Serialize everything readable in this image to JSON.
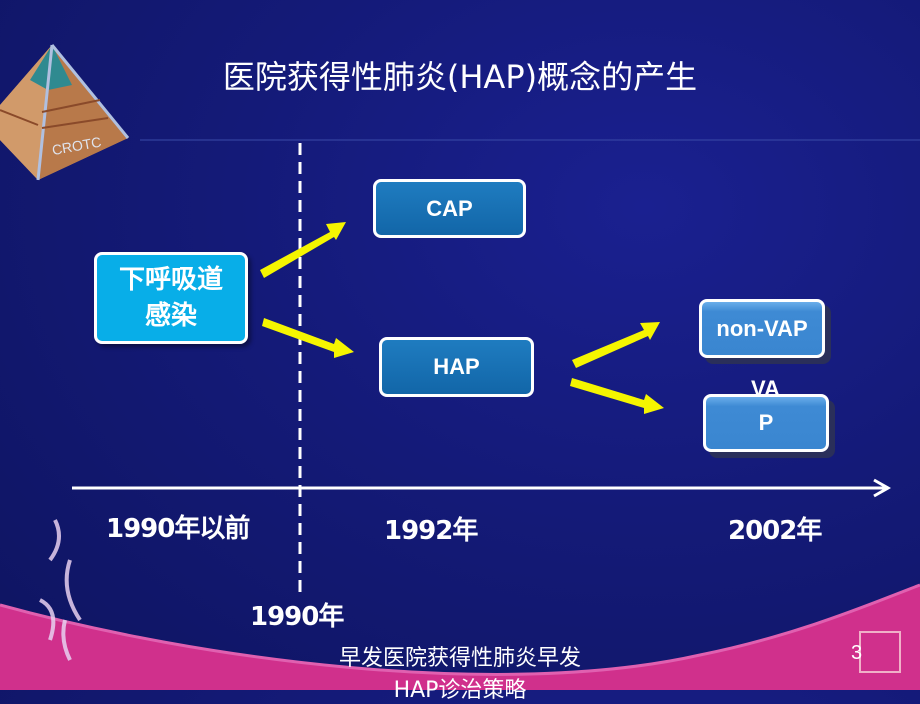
{
  "slide": {
    "title": "医院获得性肺炎(HAP)概念的产生",
    "logo_text": "CROTC",
    "boxes": {
      "origin": "下呼吸道感染",
      "origin_line1": "下呼吸道",
      "origin_line2": "感染",
      "cap": "CAP",
      "hap": "HAP",
      "non_vap": "non-VAP",
      "vap_top": "VA",
      "vap_bottom": "P"
    },
    "timeline": {
      "before_1990": "1990年以前",
      "y1992": "1992年",
      "y2002": "2002年",
      "divider_label": "1990年"
    },
    "footer": {
      "line1": "早发医院获得性肺炎早发",
      "line2": "HAP诊治策略",
      "page_number": "3"
    },
    "colors": {
      "background": "#141a78",
      "arrow": "#f5f500",
      "cyan_box": "#08aee8",
      "dark_box": "#1668ac",
      "light_box": "#3a86d0",
      "footer_band": "#d0308c"
    }
  }
}
